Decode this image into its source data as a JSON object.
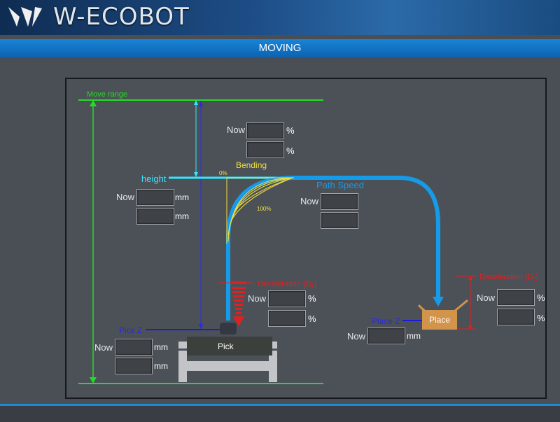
{
  "header": {
    "title": "W-ECOBOT"
  },
  "mode": {
    "title": "MOVING"
  },
  "diagram": {
    "move_range": "Move range",
    "height": "height",
    "bending": "Bending",
    "bend_0": "0%",
    "bend_100": "100%",
    "path_speed": "Path Speed",
    "decel_pick": "Deceleration (D",
    "decel_pick_sub": "1",
    "decel_place": "Deceleration (D",
    "decel_place_sub": "2",
    "pick_z": "Pick Z",
    "place_z": "Place Z",
    "pick": "Pick",
    "place": "Place"
  },
  "labels": {
    "now": "Now",
    "mm": "mm",
    "pct": "%"
  },
  "colors": {
    "accent": "#1a84d6",
    "path": "#159be8",
    "range": "#22dd22",
    "height": "#33e6ff",
    "decel": "#e02020",
    "zline": "#1c1cd8",
    "bend": "#f0e040",
    "place": "#d2934a"
  }
}
